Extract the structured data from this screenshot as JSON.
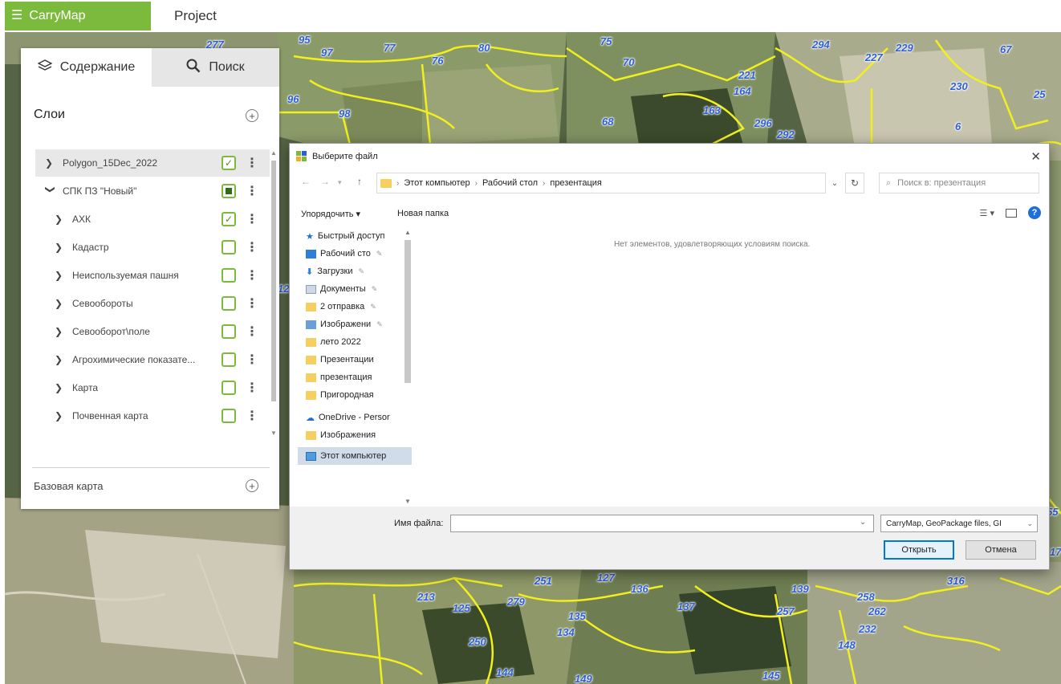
{
  "app": {
    "brand": "CarryMap",
    "project_title": "Project",
    "accent_color": "#7cba3d"
  },
  "panel": {
    "tabs": [
      {
        "label": "Содержание",
        "icon": "layers-icon",
        "active": true
      },
      {
        "label": "Поиск",
        "icon": "search-icon",
        "active": false
      }
    ],
    "layers_header": "Слои",
    "layers": [
      {
        "name": "Polygon_15Dec_2022",
        "expanded": false,
        "state": "checked",
        "level": 0,
        "selected": true
      },
      {
        "name": "СПК ПЗ \"Новый\"",
        "expanded": true,
        "state": "partial",
        "level": 0
      },
      {
        "name": "АХК",
        "expanded": false,
        "state": "checked",
        "level": 1
      },
      {
        "name": "Кадастр",
        "expanded": false,
        "state": "unchecked",
        "level": 1
      },
      {
        "name": "Неиспользуемая пашня",
        "expanded": false,
        "state": "unchecked",
        "level": 1
      },
      {
        "name": "Севообороты",
        "expanded": false,
        "state": "unchecked",
        "level": 1
      },
      {
        "name": "Севооборот\\поле",
        "expanded": false,
        "state": "unchecked",
        "level": 1
      },
      {
        "name": "Агрохимические показате...",
        "expanded": false,
        "state": "unchecked",
        "level": 1
      },
      {
        "name": "Карта",
        "expanded": false,
        "state": "unchecked",
        "level": 1
      },
      {
        "name": "Почвенная карта",
        "expanded": false,
        "state": "unchecked",
        "level": 1
      }
    ],
    "basemap_label": "Базовая карта"
  },
  "map": {
    "parcel_labels": [
      "277",
      "95",
      "97",
      "77",
      "75",
      "80",
      "76",
      "70",
      "294",
      "227",
      "229",
      "67",
      "230",
      "25",
      "221",
      "164",
      "96",
      "98",
      "163",
      "68",
      "296",
      "292",
      "6",
      "12",
      "251",
      "127",
      "136",
      "139",
      "316",
      "213",
      "279",
      "125",
      "137",
      "135",
      "134",
      "258",
      "262",
      "257",
      "232",
      "250",
      "148",
      "144",
      "149",
      "145",
      "55",
      "17"
    ]
  },
  "dialog": {
    "title": "Выберите файл",
    "breadcrumb": [
      "Этот компьютер",
      "Рабочий стол",
      "презентация"
    ],
    "search_placeholder": "Поиск в: презентация",
    "organize_label": "Упорядочить ▾",
    "new_folder_label": "Новая папка",
    "nav_items": [
      {
        "label": "Быстрый доступ",
        "icon": "star-icon",
        "pinned": false
      },
      {
        "label": "Рабочий сто",
        "icon": "desktop-icon",
        "pinned": true
      },
      {
        "label": "Загрузки",
        "icon": "download-icon",
        "pinned": true
      },
      {
        "label": "Документы",
        "icon": "document-icon",
        "pinned": true
      },
      {
        "label": "2 отправка",
        "icon": "folder-icon",
        "pinned": true
      },
      {
        "label": "Изображени",
        "icon": "image-icon",
        "pinned": true
      },
      {
        "label": "лето 2022",
        "icon": "folder-icon",
        "pinned": false
      },
      {
        "label": "Презентации",
        "icon": "folder-icon",
        "pinned": false
      },
      {
        "label": "презентация",
        "icon": "folder-icon",
        "pinned": false
      },
      {
        "label": "Пригородная",
        "icon": "folder-icon",
        "pinned": false
      },
      {
        "label": "OneDrive - Persor",
        "icon": "cloud-icon",
        "pinned": false
      },
      {
        "label": "Изображения",
        "icon": "folder-icon",
        "pinned": false
      },
      {
        "label": "Этот компьютер",
        "icon": "computer-icon",
        "pinned": false,
        "selected": true
      }
    ],
    "empty_message": "Нет элементов, удовлетворяющих условиям поиска.",
    "filename_label": "Имя файла:",
    "filename_value": "",
    "filetype_value": "CarryMap, GeoPackage files, GI",
    "open_label": "Открыть",
    "cancel_label": "Отмена"
  }
}
